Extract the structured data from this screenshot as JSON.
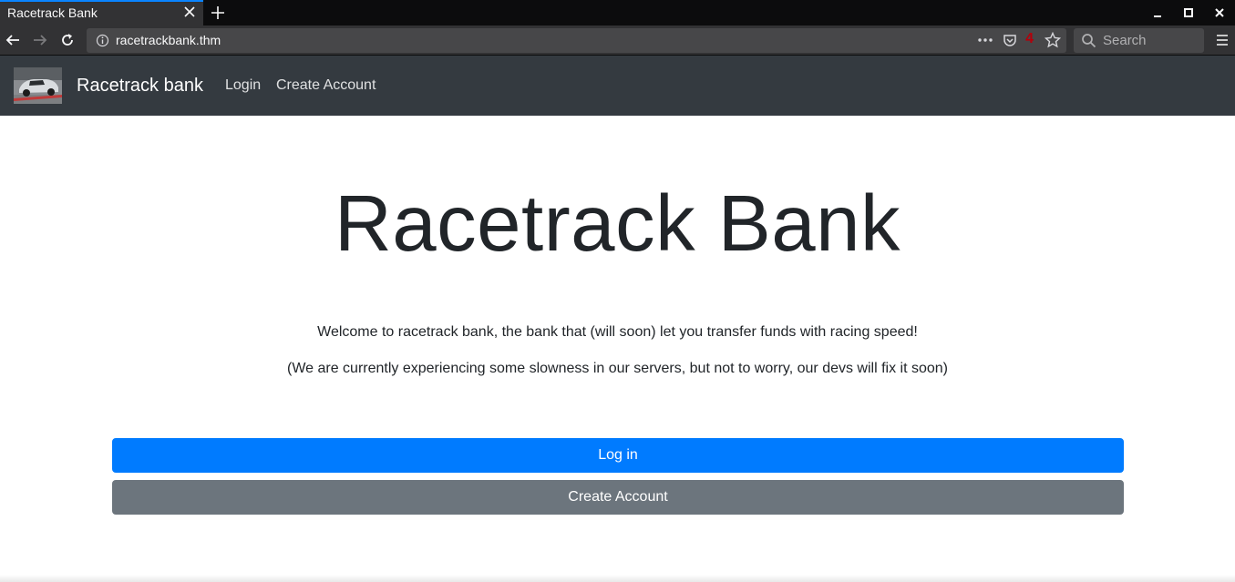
{
  "browser": {
    "tab_title": "Racetrack Bank",
    "url": "racetrackbank.thm",
    "badge_count": "4",
    "search_placeholder": "Search"
  },
  "site_nav": {
    "brand": "Racetrack bank",
    "links": [
      "Login",
      "Create Account"
    ]
  },
  "main": {
    "title": "Racetrack Bank",
    "paragraph1": "Welcome to racetrack bank, the bank that (will soon) let you transfer funds with racing speed!",
    "paragraph2": "(We are currently experiencing some slowness in our servers, but not to worry, our devs will fix it soon)",
    "login_button": "Log in",
    "create_button": "Create Account"
  },
  "colors": {
    "primary": "#007bff",
    "secondary": "#6c757d",
    "navbar": "#343a40",
    "badge": "#b3000b"
  }
}
